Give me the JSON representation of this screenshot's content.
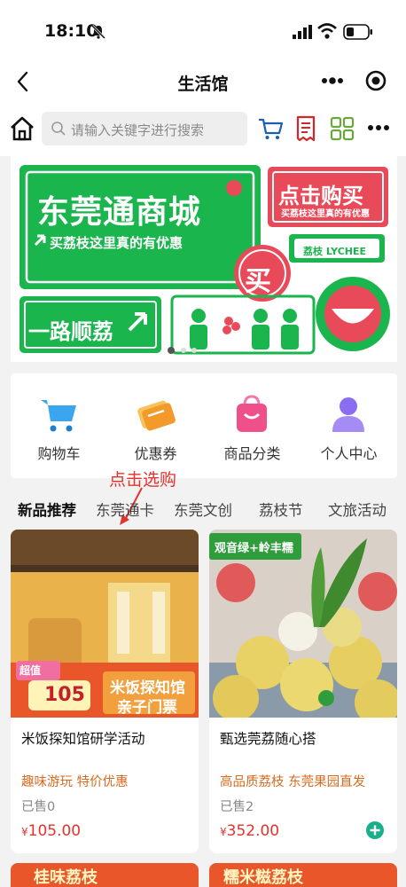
{
  "status_bar": {
    "time": "18:10"
  },
  "header": {
    "title": "生活馆"
  },
  "search": {
    "placeholder": "请输入关键字进行搜索"
  },
  "banner": {
    "title": "东莞通商城",
    "subtitle": "买荔枝这里真的有优惠",
    "buy_title": "点击购买",
    "buy_sub": "买荔枝这里真的有优惠",
    "lychee_badge": "荔枝 LYCHEE",
    "buy_stamp": "买",
    "road_text": "一路顺荔"
  },
  "quick_nav": {
    "items": [
      {
        "label": "购物车",
        "icon": "shopping-cart-icon"
      },
      {
        "label": "优惠券",
        "icon": "coupon-icon"
      },
      {
        "label": "商品分类",
        "icon": "shopping-bag-icon"
      },
      {
        "label": "个人中心",
        "icon": "person-icon"
      }
    ]
  },
  "annotation": {
    "hint": "点击选购"
  },
  "tabs": [
    "新品推荐",
    "东莞通卡",
    "东莞文创",
    "荔枝节",
    "文旅活动"
  ],
  "products": [
    {
      "name": "米饭探知馆研学活动",
      "tags": "趣味游玩 特价优惠",
      "sold": "已售0",
      "currency": "¥",
      "price": "105.00",
      "image_title": "米饭探知馆",
      "image_subtitle": "亲子门票",
      "image_badge": "超值",
      "image_price": "105"
    },
    {
      "name": "甄选莞荔随心搭",
      "tags": "高品质荔枝 东莞果园直发",
      "sold": "已售2",
      "currency": "¥",
      "price": "352.00",
      "image_title": "观音绿+岭丰糯"
    }
  ],
  "bottom_strips": [
    "桂味荔枝",
    "糯米糍荔枝"
  ],
  "colors": {
    "brand_green": "#1bb54e",
    "accent_red": "#e4322e",
    "tag_orange": "#d86a1f"
  }
}
